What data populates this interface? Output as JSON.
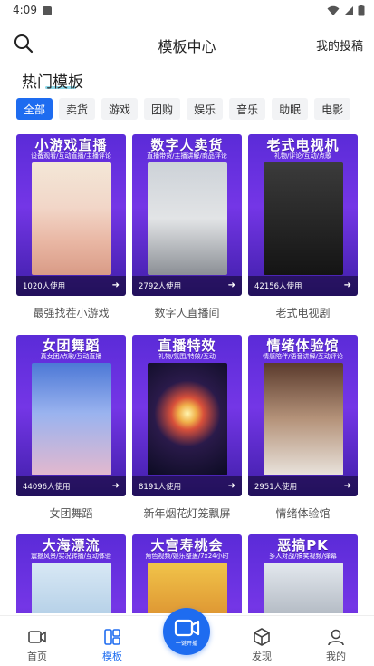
{
  "status_bar": {
    "time": "4:09"
  },
  "header": {
    "title": "模板中心",
    "my_posts": "我的投稿"
  },
  "section": {
    "title": "热门模板"
  },
  "categories": [
    {
      "label": "全部",
      "active": true
    },
    {
      "label": "卖货",
      "active": false
    },
    {
      "label": "游戏",
      "active": false
    },
    {
      "label": "团购",
      "active": false
    },
    {
      "label": "娱乐",
      "active": false
    },
    {
      "label": "音乐",
      "active": false
    },
    {
      "label": "助眠",
      "active": false
    },
    {
      "label": "电影",
      "active": false
    }
  ],
  "templates": [
    {
      "thumb_title": "小游戏直播",
      "thumb_sub": "设备观看/互动直播/主播评论",
      "usage": "1020人使用",
      "label": "最强找茬小游戏",
      "art": "lips"
    },
    {
      "thumb_title": "数字人卖货",
      "thumb_sub": "直播带货/主播讲解/商品评论",
      "usage": "2792人使用",
      "label": "数字人直播间",
      "art": "store"
    },
    {
      "thumb_title": "老式电视机",
      "thumb_sub": "礼物/评论/互动/点歌",
      "usage": "42156人使用",
      "label": "老式电视剧",
      "art": "tv"
    },
    {
      "thumb_title": "女团舞蹈",
      "thumb_sub": "真女团/点歌/互动直播",
      "usage": "44096人使用",
      "label": "女团舞蹈",
      "art": "dance"
    },
    {
      "thumb_title": "直播特效",
      "thumb_sub": "礼物/氛围/特效/互动",
      "usage": "8191人使用",
      "label": "新年烟花灯笼飘屏",
      "art": "fireworks"
    },
    {
      "thumb_title": "情绪体验馆",
      "thumb_sub": "情感陪伴/语音讲解/互动评论",
      "usage": "2951人使用",
      "label": "情绪体验馆",
      "art": "girl"
    },
    {
      "thumb_title": "大海漂流",
      "thumb_sub": "震撼风景/实况转播/互动体验",
      "usage": "",
      "label": "",
      "art": "sea"
    },
    {
      "thumb_title": "大宫寿桃会",
      "thumb_sub": "角色视频/娱乐整蛊/7x24小时",
      "usage": "",
      "label": "",
      "art": "palace"
    },
    {
      "thumb_title": "恶搞PK",
      "thumb_sub": "多人对战/搞笑视频/弹幕",
      "usage": "",
      "label": "",
      "art": "pk"
    }
  ],
  "bottom_nav": {
    "home": "首页",
    "templates": "模板",
    "live": "一键开播",
    "discover": "发现",
    "me": "我的"
  },
  "colors": {
    "accent": "#1e6cf0",
    "underline": "#8ed8e8",
    "card_purple": "#5b2bd8"
  }
}
